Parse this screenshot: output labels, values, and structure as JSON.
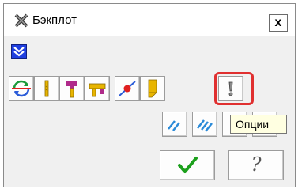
{
  "window": {
    "title": "Бэкплот",
    "close_label": "x"
  },
  "toolbar_row1": [
    {
      "icon": "cycle-arrows-icon"
    },
    {
      "icon": "tool-stick-icon"
    },
    {
      "icon": "tool-holder-icon"
    },
    {
      "icon": "tool-holder-angle-icon"
    },
    {
      "icon": "toolpath-point-icon"
    },
    {
      "icon": "stock-shape-icon"
    },
    {
      "icon": "options-icon"
    }
  ],
  "toolbar_row2": [
    {
      "icon": "step-hatch-icon"
    },
    {
      "icon": "run-hatch-icon"
    }
  ],
  "tooltip": {
    "text": "Опции"
  },
  "footer": {
    "ok_icon": "checkmark-icon",
    "help_label": "?"
  },
  "colors": {
    "highlight": "#e03030",
    "accent_blue": "#1f3fe0",
    "ok_green": "#1ca01c"
  }
}
